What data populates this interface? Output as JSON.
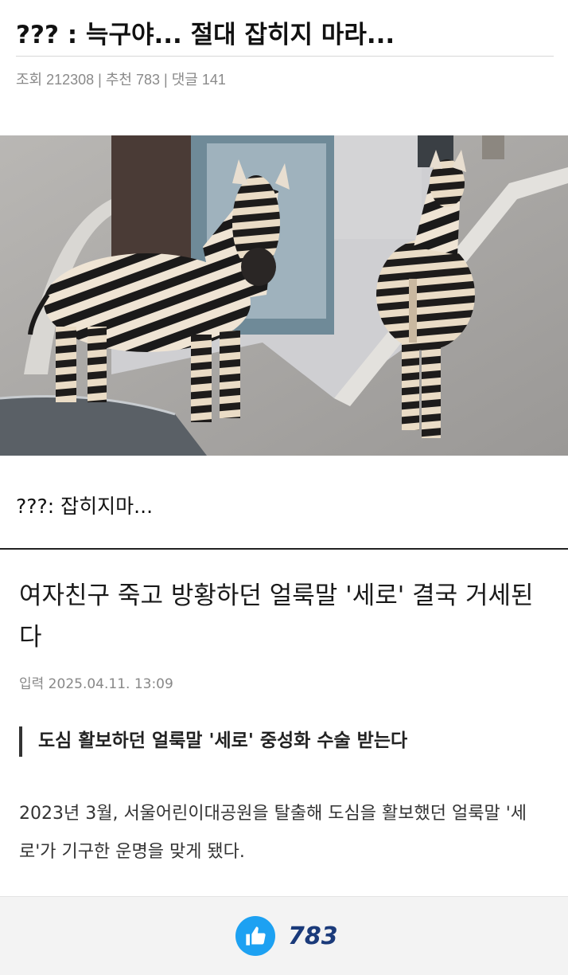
{
  "post": {
    "title": "??? : 늑구야... 절대 잡히지 마라...",
    "meta": "조회 212308 | 추천 783 | 댓글 141",
    "caption": "???: 잡히지마..."
  },
  "photo": {
    "description_icon": "zebra-photo"
  },
  "article": {
    "title": "여자친구 죽고 방황하던 얼룩말 '세로' 결국 거세된다",
    "date": "입력 2025.04.11. 13:09",
    "subhead": "도심 활보하던 얼룩말 '세로' 중성화 수술 받는다",
    "body": "2023년 3월, 서울어린이대공원을 탈출해 도심을 활보했던 얼룩말 '세로'가 기구한 운명을 맞게 됐다."
  },
  "bottom_bar": {
    "like_count": "783",
    "like_icon": "thumbs-up-icon",
    "accent": "#1da1f2"
  }
}
